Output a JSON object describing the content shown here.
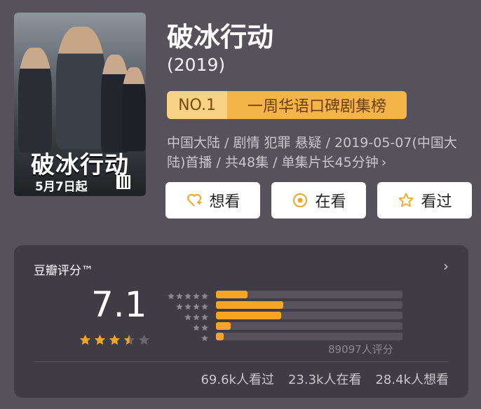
{
  "poster": {
    "title_art": "破冰行动",
    "date_art": "5月7日起"
  },
  "title": "破冰行动",
  "year": "(2019)",
  "rank": {
    "no": "NO.1",
    "label": "一周华语口碑剧集榜"
  },
  "meta": "中国大陆 / 剧情 犯罪 悬疑 / 2019-05-07(中国大陆)首播 / 共48集 / 单集片长45分钟",
  "actions": [
    {
      "label": "想看",
      "icon": "heart-plus-icon"
    },
    {
      "label": "在看",
      "icon": "target-icon"
    },
    {
      "label": "看过",
      "icon": "star-outline-icon"
    }
  ],
  "rating": {
    "header": "豆瓣评分™",
    "score": "7.1",
    "stars": 3.5,
    "distribution": [
      {
        "stars": 5,
        "fraction": 0.17
      },
      {
        "stars": 4,
        "fraction": 0.36
      },
      {
        "stars": 3,
        "fraction": 0.35
      },
      {
        "stars": 2,
        "fraction": 0.08
      },
      {
        "stars": 1,
        "fraction": 0.04
      }
    ],
    "count": "89097人评分",
    "stats": {
      "watched": "69.6k人看过",
      "watching": "23.3k人在看",
      "want": "28.4k人想看"
    }
  },
  "colors": {
    "accent": "#f5a524",
    "background": "#56525c",
    "card": "#403c45",
    "rank_gold": "#f3b54a"
  }
}
